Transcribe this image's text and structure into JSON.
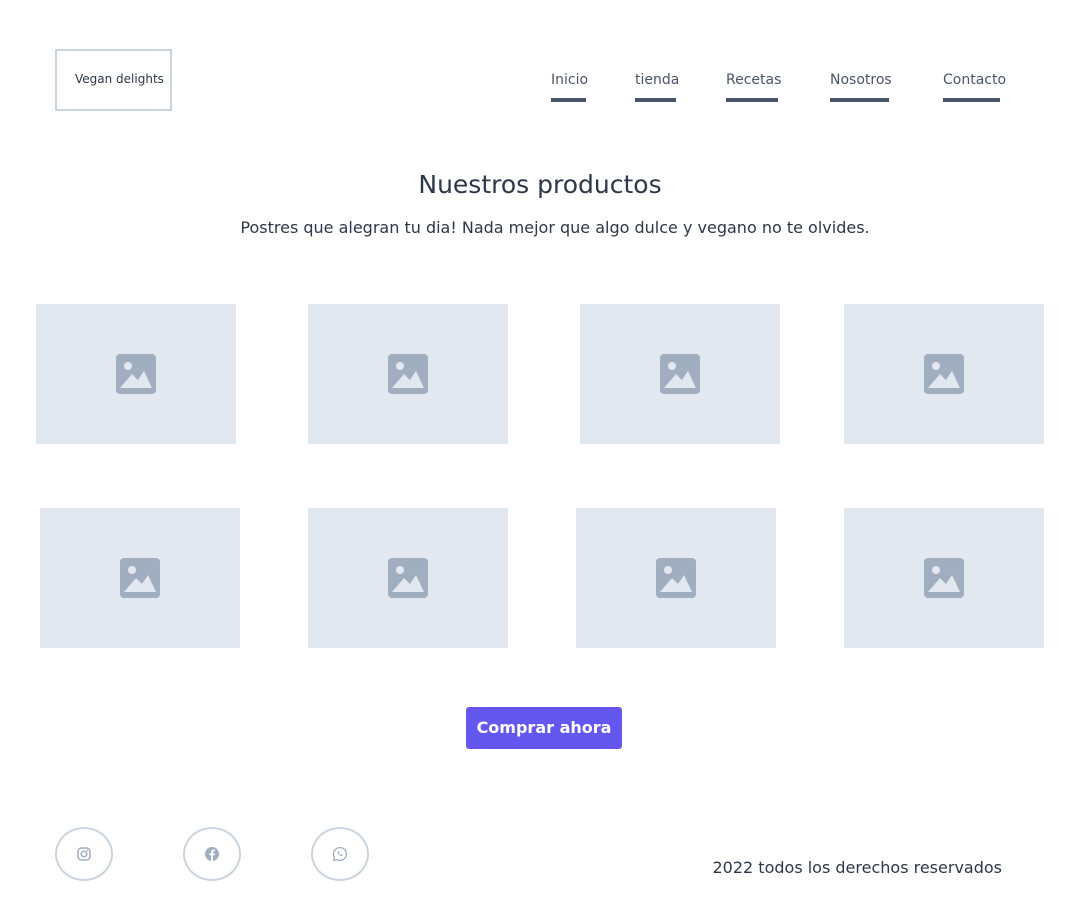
{
  "brand": {
    "logo_text": "Vegan delights"
  },
  "nav": {
    "items": [
      {
        "label": "Inicio"
      },
      {
        "label": "tienda"
      },
      {
        "label": "Recetas"
      },
      {
        "label": "Nosotros"
      },
      {
        "label": "Contacto"
      }
    ]
  },
  "main": {
    "title": "Nuestros productos",
    "subtitle": "Postres que alegran tu dia! Nada mejor que algo dulce y vegano no te olvides.",
    "product_image_icon": "image-placeholder-icon",
    "cta_label": "Comprar ahora"
  },
  "footer": {
    "social": [
      {
        "icon": "instagram-icon"
      },
      {
        "icon": "facebook-icon"
      },
      {
        "icon": "whatsapp-icon"
      }
    ],
    "copyright": "2022 todos los derechos reservados"
  },
  "colors": {
    "accent": "#6457f0",
    "placeholder_bg": "#e2e8f0",
    "placeholder_icon": "#a0aec0",
    "border": "#cbd5e0",
    "text": "#2d3748"
  }
}
